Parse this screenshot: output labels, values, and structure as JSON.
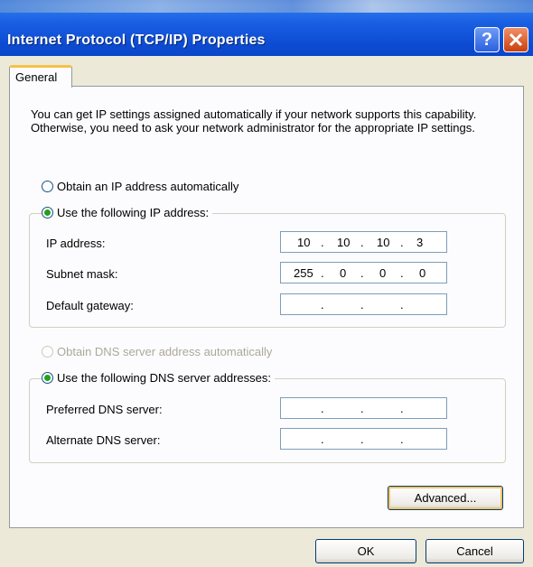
{
  "window": {
    "title": "Internet Protocol (TCP/IP) Properties",
    "help_label": "?",
    "close_label": "✕"
  },
  "tabs": [
    {
      "label": "General"
    }
  ],
  "info_text": "You can get IP settings assigned automatically if your network supports this capability. Otherwise, you need to ask your network administrator for the appropriate IP settings.",
  "ip_section": {
    "auto_label": "Obtain an IP address automatically",
    "manual_label": "Use the following IP address:",
    "fields": [
      {
        "label": "IP address:",
        "octets": [
          "10",
          "10",
          "10",
          "3"
        ]
      },
      {
        "label": "Subnet mask:",
        "octets": [
          "255",
          "0",
          "0",
          "0"
        ]
      },
      {
        "label": "Default gateway:",
        "octets": [
          "",
          "",
          "",
          ""
        ]
      }
    ]
  },
  "dns_section": {
    "auto_label": "Obtain DNS server address automatically",
    "manual_label": "Use the following DNS server addresses:",
    "fields": [
      {
        "label": "Preferred DNS server:",
        "octets": [
          "",
          "",
          "",
          ""
        ]
      },
      {
        "label": "Alternate DNS server:",
        "octets": [
          "",
          "",
          "",
          ""
        ]
      }
    ]
  },
  "buttons": {
    "advanced": "Advanced...",
    "ok": "OK",
    "cancel": "Cancel"
  },
  "colors": {
    "titlebar": "#0a4fd6",
    "radio_selected": "#21a121",
    "close_button": "#c8400f"
  }
}
